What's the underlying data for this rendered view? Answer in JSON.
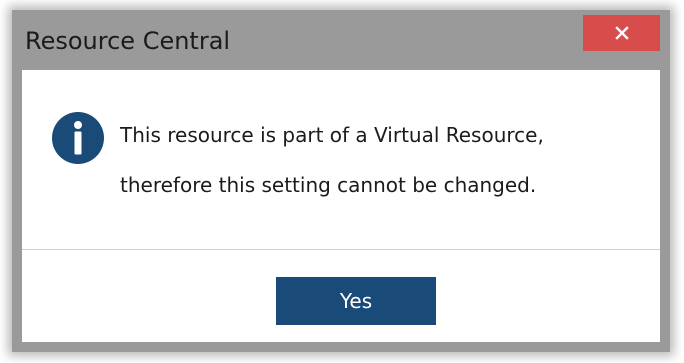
{
  "dialog": {
    "title": "Resource Central",
    "close_icon": "close-icon",
    "info_icon": "info-icon",
    "message_lines": [
      "This resource is part of a Virtual Resource,",
      "therefore this setting cannot be changed."
    ],
    "yes_label": "Yes"
  },
  "colors": {
    "frame": "#9a9a9a",
    "close_button": "#d84c4c",
    "info_icon": "#194a78",
    "primary_button": "#194a78",
    "content_bg": "#ffffff",
    "divider": "#cfcfcf"
  }
}
